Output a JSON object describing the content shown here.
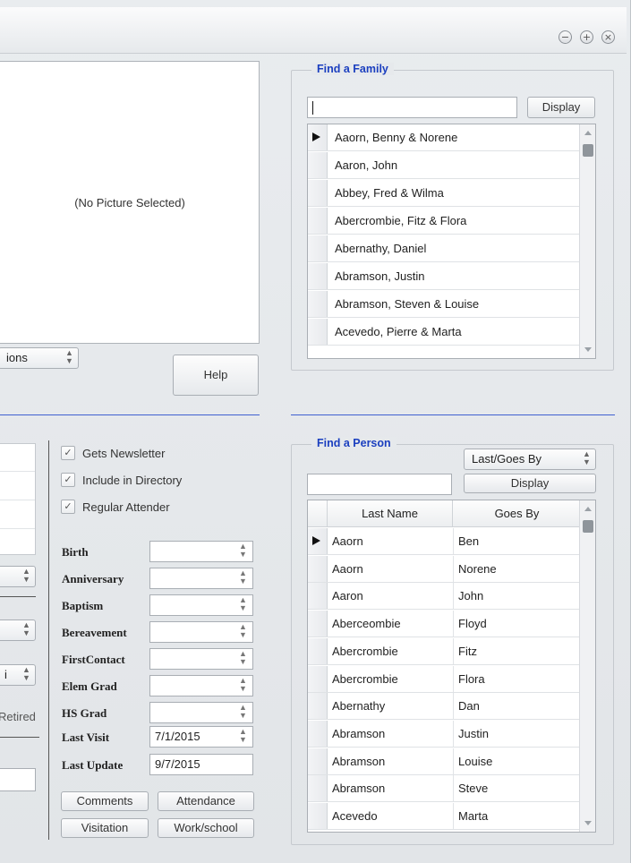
{
  "window": {
    "controls": {
      "minimize": "−",
      "maximize": "+",
      "close": "×"
    }
  },
  "picture": {
    "placeholder": "(No Picture Selected)",
    "select_value": "ions"
  },
  "help_label": "Help",
  "find_family": {
    "title": "Find a Family",
    "search_value": "",
    "display_label": "Display",
    "rows": [
      "Aaorn, Benny & Norene",
      "Aaron, John",
      "Abbey, Fred & Wilma",
      "Abercrombie, Fitz & Flora",
      "Abernathy, Daniel",
      "Abramson, Justin",
      "Abramson, Steven & Louise",
      "Acevedo, Pierre & Marta"
    ],
    "selected_index": 0
  },
  "checkboxes": [
    {
      "label": "Gets Newsletter",
      "checked": true
    },
    {
      "label": "Include in Directory",
      "checked": true
    },
    {
      "label": "Regular Attender",
      "checked": true
    }
  ],
  "dates": [
    {
      "label": "Birth",
      "value": ""
    },
    {
      "label": "Anniversary",
      "value": ""
    },
    {
      "label": "Baptism",
      "value": ""
    },
    {
      "label": "Bereavement",
      "value": ""
    },
    {
      "label": "FirstContact",
      "value": ""
    },
    {
      "label": "Elem Grad",
      "value": ""
    },
    {
      "label": "HS Grad",
      "value": ""
    },
    {
      "label": "Last Visit",
      "value": "7/1/2015"
    },
    {
      "label": "Last Update",
      "value": "9/7/2015"
    }
  ],
  "left_partial": {
    "select3_value": "i",
    "retired_label": "Retired"
  },
  "buttons": {
    "comments": "Comments",
    "attendance": "Attendance",
    "visitation": "Visitation",
    "work_school": "Work/school"
  },
  "find_person": {
    "title": "Find a Person",
    "sort_value": "Last/Goes By",
    "search_value": "",
    "display_label": "Display",
    "columns": [
      "Last Name",
      "Goes By"
    ],
    "rows": [
      [
        "Aaorn",
        "Ben"
      ],
      [
        "Aaorn",
        "Norene"
      ],
      [
        "Aaron",
        "John"
      ],
      [
        "Aberceombie",
        "Floyd"
      ],
      [
        "Abercrombie",
        "Fitz"
      ],
      [
        "Abercrombie",
        "Flora"
      ],
      [
        "Abernathy",
        "Dan"
      ],
      [
        "Abramson",
        "Justin"
      ],
      [
        "Abramson",
        "Louise"
      ],
      [
        "Abramson",
        "Steve"
      ],
      [
        "Acevedo",
        "Marta"
      ]
    ],
    "selected_index": 0
  }
}
